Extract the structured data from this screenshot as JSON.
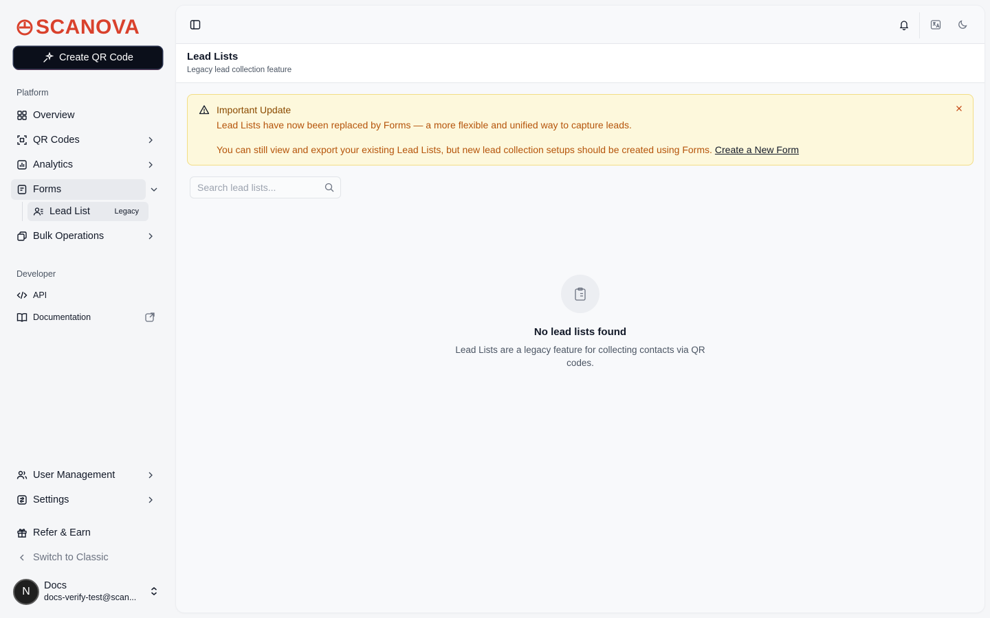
{
  "brand": {
    "name": "SCANOVA",
    "color": "#d9412c"
  },
  "sidebar": {
    "create_button": "Create QR Code",
    "platform_label": "Platform",
    "platform_items": [
      {
        "label": "Overview",
        "icon": "grid-icon"
      },
      {
        "label": "QR Codes",
        "icon": "qr-scan-icon"
      },
      {
        "label": "Analytics",
        "icon": "bar-chart-icon"
      },
      {
        "label": "Forms",
        "icon": "form-icon"
      }
    ],
    "sub_item": {
      "label": "Lead List",
      "badge": "Legacy",
      "icon": "contact-list-icon"
    },
    "bulk_item": {
      "label": "Bulk Operations",
      "icon": "stack-icon"
    },
    "developer_label": "Developer",
    "developer_items": [
      {
        "label": "API",
        "icon": "code-icon"
      },
      {
        "label": "Documentation",
        "icon": "book-icon"
      }
    ],
    "bottom_items": [
      {
        "label": "User Management",
        "icon": "users-icon"
      },
      {
        "label": "Settings",
        "icon": "settings-icon"
      },
      {
        "label": "Refer & Earn",
        "icon": "gift-icon"
      },
      {
        "label": "Switch to Classic",
        "icon": "chevron-left-icon"
      }
    ],
    "user": {
      "initial": "N",
      "name": "Docs",
      "email": "docs-verify-test@scan..."
    }
  },
  "header": {
    "title": "Lead Lists",
    "subtitle": "Legacy lead collection feature"
  },
  "alert": {
    "title": "Important Update",
    "line1": "Lead Lists have now been replaced by Forms — a more flexible and unified way to capture leads.",
    "line2": "You can still view and export your existing Lead Lists, but new lead collection setups should be created using Forms.",
    "link": "Create a New Form",
    "bg_color": "#fdf8dc",
    "text_color": "#b5540a"
  },
  "search": {
    "placeholder": "Search lead lists...",
    "value": ""
  },
  "empty_state": {
    "title": "No lead lists found",
    "description": "Lead Lists are a legacy feature for collecting contacts via QR codes."
  }
}
